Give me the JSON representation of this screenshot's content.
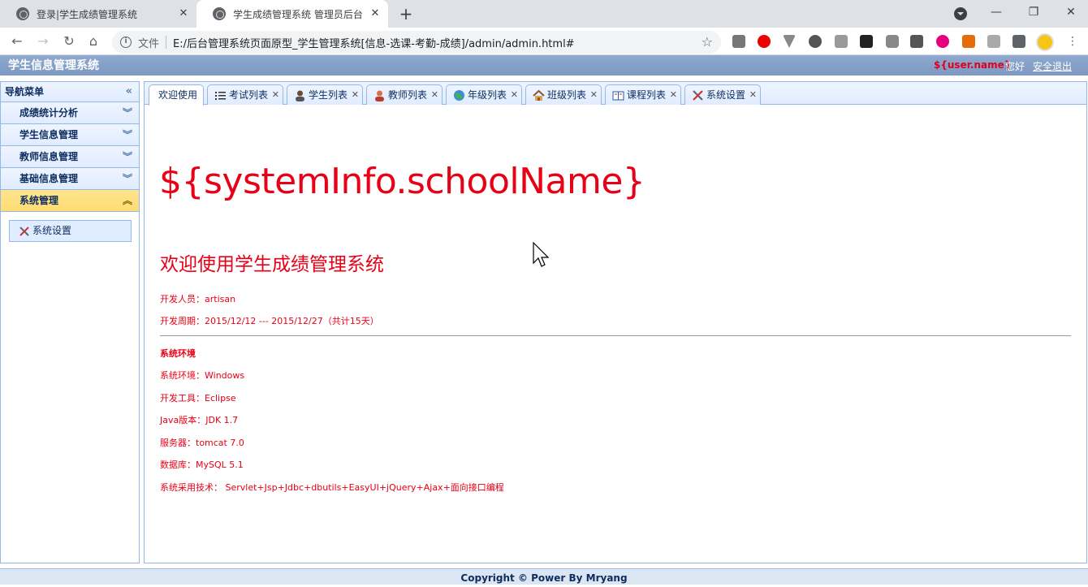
{
  "browser": {
    "tabs": [
      {
        "title": "登录|学生成绩管理系统"
      },
      {
        "title": "学生成绩管理系统 管理员后台"
      }
    ],
    "address": {
      "scheme": "文件",
      "url": "E:/后台管理系统页面原型_学生管理系统[信息-选课-考勤-成绩]/admin/admin.html#"
    }
  },
  "header": {
    "title": "学生信息管理系统",
    "user_name": "${user.name}",
    "greeting": "您好",
    "logout": "安全退出"
  },
  "sidebar": {
    "title": "导航菜单",
    "sections": [
      {
        "label": "成绩统计分析",
        "active": false
      },
      {
        "label": "学生信息管理",
        "active": false
      },
      {
        "label": "教师信息管理",
        "active": false
      },
      {
        "label": "基础信息管理",
        "active": false
      },
      {
        "label": "系统管理",
        "active": true
      }
    ],
    "sub_items": [
      {
        "label": "系统设置",
        "icon": "tools-icon"
      }
    ]
  },
  "content_tabs": [
    {
      "label": "欢迎使用",
      "icon": "",
      "selected": true
    },
    {
      "label": "考试列表",
      "icon": "list-icon"
    },
    {
      "label": "学生列表",
      "icon": "student-icon"
    },
    {
      "label": "教师列表",
      "icon": "teacher-icon"
    },
    {
      "label": "年级列表",
      "icon": "globe-icon"
    },
    {
      "label": "班级列表",
      "icon": "house-icon"
    },
    {
      "label": "课程列表",
      "icon": "book-icon"
    },
    {
      "label": "系统设置",
      "icon": "tools-icon"
    }
  ],
  "welcome": {
    "school_name": "${systemInfo.schoolName}",
    "title": "欢迎使用学生成绩管理系统",
    "developer": "开发人员：artisan",
    "period": "开发周期：2015/12/12 --- 2015/12/27（共计15天）",
    "env_heading": "系统环境",
    "env_lines": [
      "系统环境：Windows",
      "开发工具：Eclipse",
      "Java版本：JDK 1.7",
      "服务器：tomcat 7.0",
      "数据库：MySQL 5.1",
      "系统采用技术： Servlet+Jsp+Jdbc+dbutils+EasyUI+jQuery+Ajax+面向接口编程"
    ]
  },
  "footer": {
    "text": "Copyright © Power By Mryang"
  },
  "colors": {
    "accent": "#e80016",
    "header_bg": "#7d99c2",
    "panel_border": "#95b8e7",
    "active_menu": "#ffdc75"
  }
}
